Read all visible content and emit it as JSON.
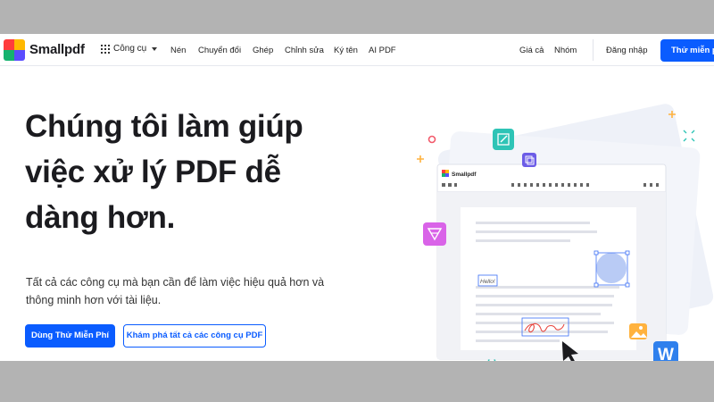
{
  "nav": {
    "brand": "Smallpdf",
    "tools_label": "Công cụ",
    "links": [
      "Nén",
      "Chuyển đổi",
      "Ghép",
      "Chỉnh sửa",
      "Ký tên",
      "AI PDF"
    ],
    "right_links": [
      "Giá cả",
      "Nhóm"
    ],
    "login": "Đăng nhập",
    "try_free": "Thử miễn phí"
  },
  "hero": {
    "title": "Chúng tôi làm giúp việc xử lý PDF dễ dàng hơn.",
    "subtitle": "Tất cả các công cụ mà bạn cần để làm việc hiệu quả hơn và thông minh hơn với tài liệu.",
    "cta_primary": "Dùng Thử Miễn Phí",
    "cta_secondary": "Khám phá tất cả các công cụ PDF"
  },
  "illustration": {
    "app_brand": "Smallpdf",
    "hello_text": "Hello!",
    "word_letter": "W"
  },
  "colors": {
    "accent": "#0a5cff",
    "logo": [
      "#ff3c3c",
      "#ffb800",
      "#16b26f",
      "#5a4cff"
    ]
  }
}
